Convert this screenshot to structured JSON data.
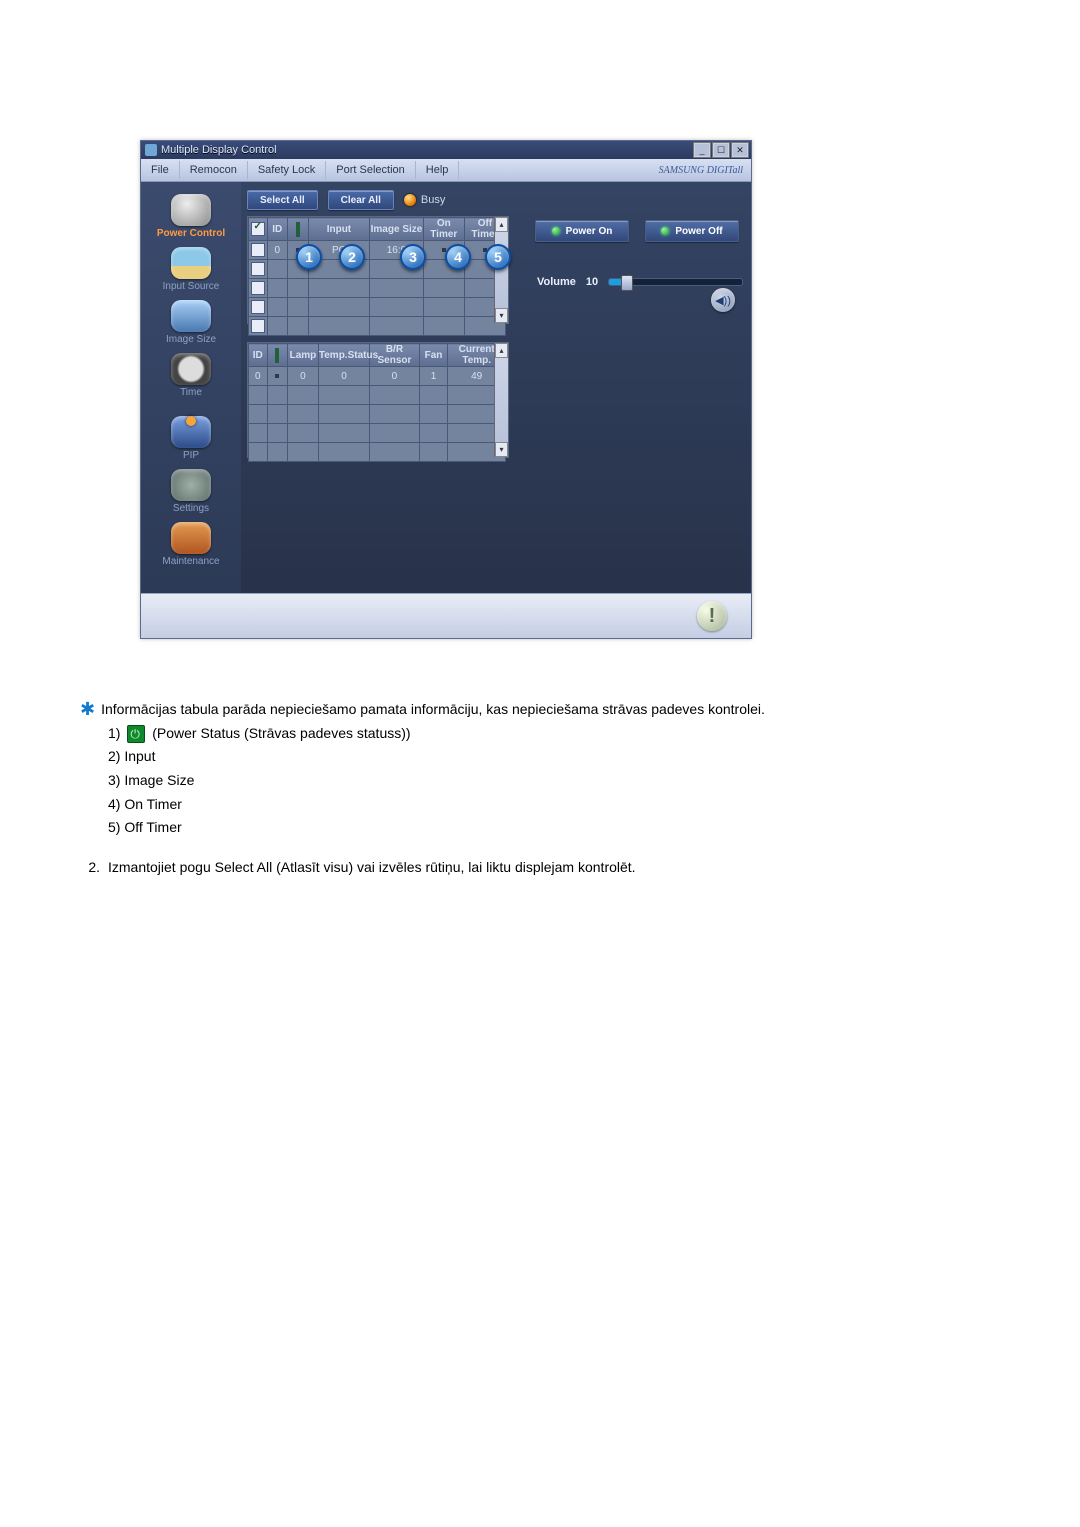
{
  "window": {
    "title": "Multiple Display Control",
    "menu": {
      "file": "File",
      "remocon": "Remocon",
      "safety": "Safety Lock",
      "port": "Port Selection",
      "help": "Help"
    },
    "brand": "SAMSUNG DIGITall"
  },
  "sidebar": {
    "power": "Power Control",
    "input_source": "Input Source",
    "image_size": "Image Size",
    "time": "Time",
    "pip": "PIP",
    "settings": "Settings",
    "maintenance": "Maintenance"
  },
  "toolbar": {
    "select_all": "Select All",
    "clear_all": "Clear All",
    "busy": "Busy"
  },
  "table1": {
    "headers": {
      "chk": "",
      "id": "ID",
      "pwr": "",
      "input": "Input",
      "image_size": "Image Size",
      "on_timer": "On Timer",
      "off_timer": "Off Timer"
    },
    "rows": [
      {
        "id": "0",
        "input": "PC",
        "image_size": "16:9",
        "on_timer": "",
        "off_timer": ""
      },
      {
        "id": "",
        "input": "",
        "image_size": "",
        "on_timer": "",
        "off_timer": ""
      },
      {
        "id": "",
        "input": "",
        "image_size": "",
        "on_timer": "",
        "off_timer": ""
      },
      {
        "id": "",
        "input": "",
        "image_size": "",
        "on_timer": "",
        "off_timer": ""
      },
      {
        "id": "",
        "input": "",
        "image_size": "",
        "on_timer": "",
        "off_timer": ""
      }
    ]
  },
  "table2": {
    "headers": {
      "id": "ID",
      "pwr": "",
      "lamp": "Lamp",
      "tempstatus": "Temp.Status",
      "brsensor": "B/R Sensor",
      "fan": "Fan",
      "curtemp": "Current Temp."
    },
    "rows": [
      {
        "id": "0",
        "lamp": "0",
        "tempstatus": "0",
        "brsensor": "0",
        "fan": "1",
        "curtemp": "49"
      },
      {
        "id": "",
        "lamp": "",
        "tempstatus": "",
        "brsensor": "",
        "fan": "",
        "curtemp": ""
      },
      {
        "id": "",
        "lamp": "",
        "tempstatus": "",
        "brsensor": "",
        "fan": "",
        "curtemp": ""
      },
      {
        "id": "",
        "lamp": "",
        "tempstatus": "",
        "brsensor": "",
        "fan": "",
        "curtemp": ""
      },
      {
        "id": "",
        "lamp": "",
        "tempstatus": "",
        "brsensor": "",
        "fan": "",
        "curtemp": ""
      }
    ]
  },
  "control": {
    "power_on": "Power On",
    "power_off": "Power Off",
    "volume_label": "Volume",
    "volume_value": "10"
  },
  "callouts": [
    "1",
    "2",
    "3",
    "4",
    "5"
  ],
  "doc": {
    "lead": "Informācijas tabula parāda nepieciešamo pamata informāciju, kas nepieciešama strāvas padeves kontrolei.",
    "item1_pre": "1)",
    "item1_post": "(Power Status (Strāvas padeves statuss))",
    "item2": "2) Input",
    "item3": "3) Image Size",
    "item4": "4) On Timer",
    "item5": "5) Off Timer",
    "step2_n": "2.",
    "step2": "Izmantojiet pogu Select All (Atlasīt visu) vai izvēles rūtiņu, lai liktu displejam kontrolēt."
  }
}
